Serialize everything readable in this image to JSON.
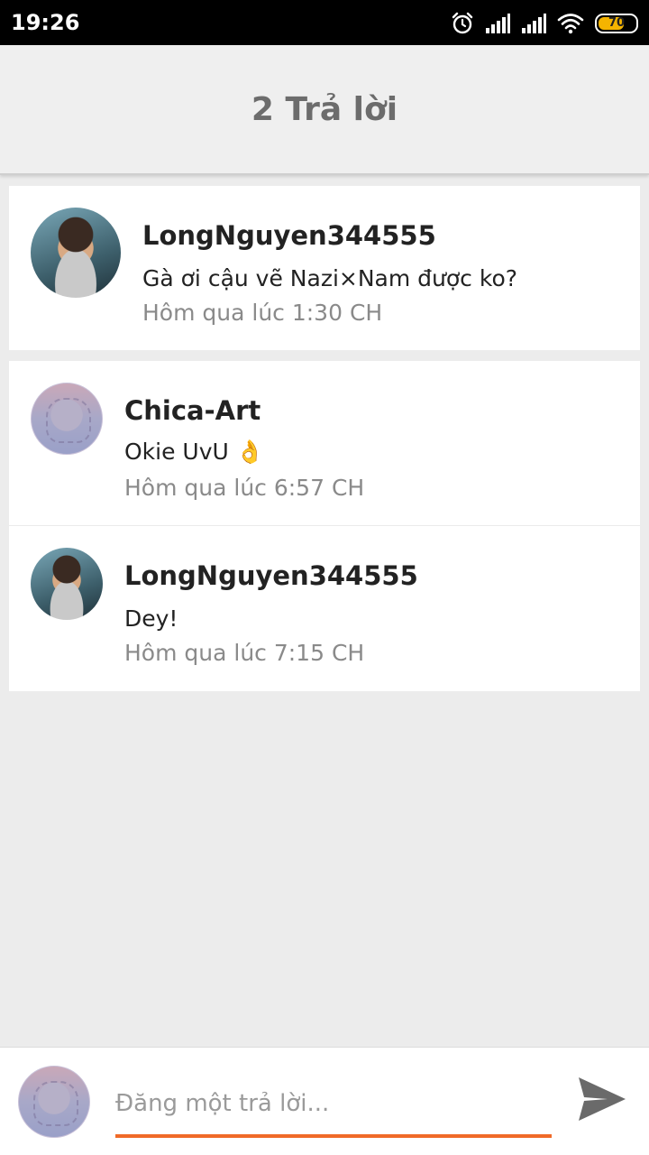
{
  "status_bar": {
    "time": "19:26",
    "battery": "70",
    "icons": [
      "alarm-icon",
      "signal-icon",
      "signal-icon",
      "wifi-icon",
      "battery-icon"
    ]
  },
  "header": {
    "title": "2 Trả lời"
  },
  "main_comment": {
    "author": "LongNguyen344555",
    "text": "Gà ơi cậu vẽ Nazi×Nam được ko?",
    "time": "Hôm qua lúc 1:30 CH"
  },
  "replies": [
    {
      "author": "Chica-Art",
      "text": "Okie UvU 👌",
      "time": "Hôm qua lúc 6:57 CH"
    },
    {
      "author": "LongNguyen344555",
      "text": "Dey!",
      "time": "Hôm qua lúc 7:15 CH"
    }
  ],
  "composer": {
    "placeholder": "Đăng một trả lời...",
    "value": "",
    "send_icon": "send-icon",
    "accent_color": "#f06a28"
  }
}
